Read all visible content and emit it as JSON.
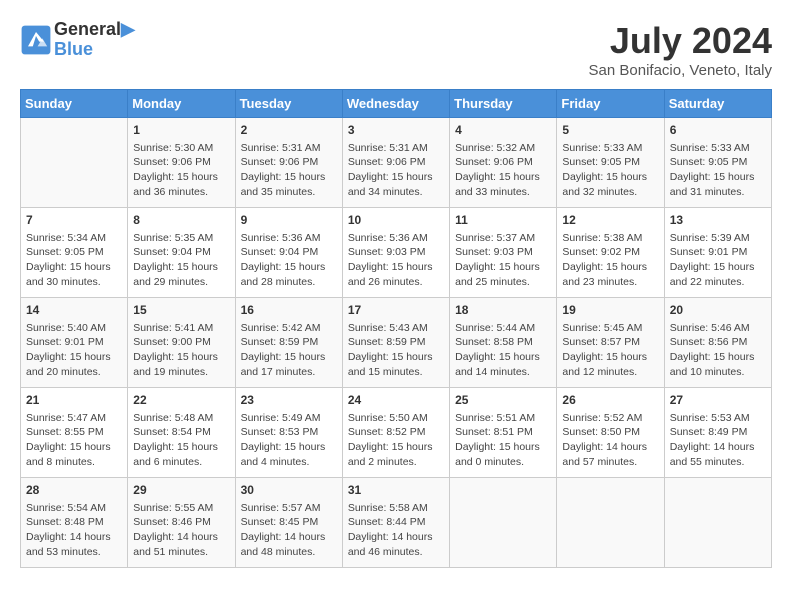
{
  "header": {
    "logo_line1": "General",
    "logo_line2": "Blue",
    "month": "July 2024",
    "location": "San Bonifacio, Veneto, Italy"
  },
  "days_of_week": [
    "Sunday",
    "Monday",
    "Tuesday",
    "Wednesday",
    "Thursday",
    "Friday",
    "Saturday"
  ],
  "weeks": [
    [
      {
        "day": "",
        "info": ""
      },
      {
        "day": "1",
        "info": "Sunrise: 5:30 AM\nSunset: 9:06 PM\nDaylight: 15 hours\nand 36 minutes."
      },
      {
        "day": "2",
        "info": "Sunrise: 5:31 AM\nSunset: 9:06 PM\nDaylight: 15 hours\nand 35 minutes."
      },
      {
        "day": "3",
        "info": "Sunrise: 5:31 AM\nSunset: 9:06 PM\nDaylight: 15 hours\nand 34 minutes."
      },
      {
        "day": "4",
        "info": "Sunrise: 5:32 AM\nSunset: 9:06 PM\nDaylight: 15 hours\nand 33 minutes."
      },
      {
        "day": "5",
        "info": "Sunrise: 5:33 AM\nSunset: 9:05 PM\nDaylight: 15 hours\nand 32 minutes."
      },
      {
        "day": "6",
        "info": "Sunrise: 5:33 AM\nSunset: 9:05 PM\nDaylight: 15 hours\nand 31 minutes."
      }
    ],
    [
      {
        "day": "7",
        "info": "Sunrise: 5:34 AM\nSunset: 9:05 PM\nDaylight: 15 hours\nand 30 minutes."
      },
      {
        "day": "8",
        "info": "Sunrise: 5:35 AM\nSunset: 9:04 PM\nDaylight: 15 hours\nand 29 minutes."
      },
      {
        "day": "9",
        "info": "Sunrise: 5:36 AM\nSunset: 9:04 PM\nDaylight: 15 hours\nand 28 minutes."
      },
      {
        "day": "10",
        "info": "Sunrise: 5:36 AM\nSunset: 9:03 PM\nDaylight: 15 hours\nand 26 minutes."
      },
      {
        "day": "11",
        "info": "Sunrise: 5:37 AM\nSunset: 9:03 PM\nDaylight: 15 hours\nand 25 minutes."
      },
      {
        "day": "12",
        "info": "Sunrise: 5:38 AM\nSunset: 9:02 PM\nDaylight: 15 hours\nand 23 minutes."
      },
      {
        "day": "13",
        "info": "Sunrise: 5:39 AM\nSunset: 9:01 PM\nDaylight: 15 hours\nand 22 minutes."
      }
    ],
    [
      {
        "day": "14",
        "info": "Sunrise: 5:40 AM\nSunset: 9:01 PM\nDaylight: 15 hours\nand 20 minutes."
      },
      {
        "day": "15",
        "info": "Sunrise: 5:41 AM\nSunset: 9:00 PM\nDaylight: 15 hours\nand 19 minutes."
      },
      {
        "day": "16",
        "info": "Sunrise: 5:42 AM\nSunset: 8:59 PM\nDaylight: 15 hours\nand 17 minutes."
      },
      {
        "day": "17",
        "info": "Sunrise: 5:43 AM\nSunset: 8:59 PM\nDaylight: 15 hours\nand 15 minutes."
      },
      {
        "day": "18",
        "info": "Sunrise: 5:44 AM\nSunset: 8:58 PM\nDaylight: 15 hours\nand 14 minutes."
      },
      {
        "day": "19",
        "info": "Sunrise: 5:45 AM\nSunset: 8:57 PM\nDaylight: 15 hours\nand 12 minutes."
      },
      {
        "day": "20",
        "info": "Sunrise: 5:46 AM\nSunset: 8:56 PM\nDaylight: 15 hours\nand 10 minutes."
      }
    ],
    [
      {
        "day": "21",
        "info": "Sunrise: 5:47 AM\nSunset: 8:55 PM\nDaylight: 15 hours\nand 8 minutes."
      },
      {
        "day": "22",
        "info": "Sunrise: 5:48 AM\nSunset: 8:54 PM\nDaylight: 15 hours\nand 6 minutes."
      },
      {
        "day": "23",
        "info": "Sunrise: 5:49 AM\nSunset: 8:53 PM\nDaylight: 15 hours\nand 4 minutes."
      },
      {
        "day": "24",
        "info": "Sunrise: 5:50 AM\nSunset: 8:52 PM\nDaylight: 15 hours\nand 2 minutes."
      },
      {
        "day": "25",
        "info": "Sunrise: 5:51 AM\nSunset: 8:51 PM\nDaylight: 15 hours\nand 0 minutes."
      },
      {
        "day": "26",
        "info": "Sunrise: 5:52 AM\nSunset: 8:50 PM\nDaylight: 14 hours\nand 57 minutes."
      },
      {
        "day": "27",
        "info": "Sunrise: 5:53 AM\nSunset: 8:49 PM\nDaylight: 14 hours\nand 55 minutes."
      }
    ],
    [
      {
        "day": "28",
        "info": "Sunrise: 5:54 AM\nSunset: 8:48 PM\nDaylight: 14 hours\nand 53 minutes."
      },
      {
        "day": "29",
        "info": "Sunrise: 5:55 AM\nSunset: 8:46 PM\nDaylight: 14 hours\nand 51 minutes."
      },
      {
        "day": "30",
        "info": "Sunrise: 5:57 AM\nSunset: 8:45 PM\nDaylight: 14 hours\nand 48 minutes."
      },
      {
        "day": "31",
        "info": "Sunrise: 5:58 AM\nSunset: 8:44 PM\nDaylight: 14 hours\nand 46 minutes."
      },
      {
        "day": "",
        "info": ""
      },
      {
        "day": "",
        "info": ""
      },
      {
        "day": "",
        "info": ""
      }
    ]
  ]
}
